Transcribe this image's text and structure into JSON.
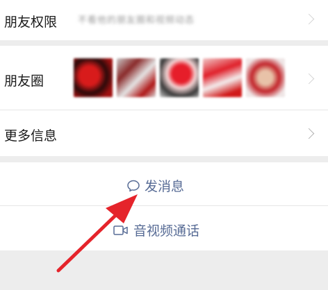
{
  "rows": {
    "friend_permissions": {
      "label": "朋友权限",
      "value": "不看他的朋友圈和视频动态"
    },
    "moments": {
      "label": "朋友圈"
    },
    "more_info": {
      "label": "更多信息"
    }
  },
  "actions": {
    "send_message": {
      "label": "发消息",
      "icon": "chat-bubble-icon"
    },
    "av_call": {
      "label": "音视频通话",
      "icon": "video-camera-icon"
    }
  },
  "colors": {
    "link": "#576b95",
    "background": "#ededed",
    "arrow": "#e5242b"
  }
}
